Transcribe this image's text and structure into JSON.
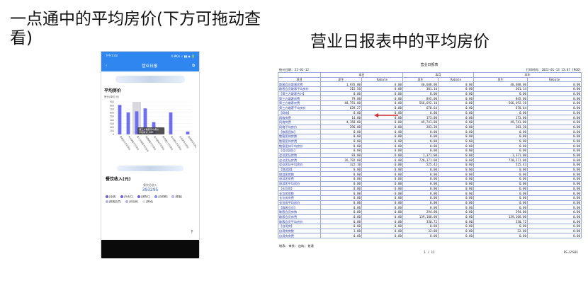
{
  "headings": {
    "left": "一点通中的平均房价(下方可拖动查看)",
    "right": "营业日报表中的平均房价"
  },
  "phone": {
    "status_left": "下午1:43",
    "status_right": "0.8K/s ⚡ ▮▮ ◉ 🔋",
    "title": "营业日报",
    "avg_price_title": "平均房价",
    "unit_label": "房价(单位:元)",
    "y_ticks": [
      "900",
      "800",
      "700",
      "600",
      "500",
      "400",
      "300",
      "200",
      "100",
      "0"
    ],
    "tooltip": [
      "第三方散客平均房价",
      "平均房价: 639"
    ],
    "food_title": "餐饮收入(元)",
    "food_sub": "餐饮总收入",
    "food_value": "393295",
    "legend": [
      {
        "label": "[全部]",
        "color": "#6a5cd6"
      },
      {
        "label": "[外卖汇]",
        "color": "#6a5cd6"
      },
      {
        "label": "[团购汇]",
        "color": "#6a5cd6"
      },
      {
        "label": "[自助餐]",
        "color": "#7d8fe6"
      },
      {
        "label": "[散客]",
        "color": "#b3b3e6"
      },
      {
        "label": "[散客会员]",
        "color": "#b3b3e6"
      },
      {
        "label": "[长包房]",
        "color": "#b3b3e6"
      },
      {
        "label": "[其他]",
        "color": "#e0e0e0"
      }
    ]
  },
  "chart_data": {
    "type": "bar",
    "categories": [
      "散客会员平均房价",
      "协议散客平均房价",
      "第三方散客平均房价",
      "网络散客平均房价",
      "会员团体平均房价",
      "旅游团队平均房价",
      "会议团队平均房价",
      "长包房平均房价",
      "自用房平均房价"
    ],
    "values": [
      815,
      610,
      639,
      720,
      340,
      0,
      610,
      0,
      80
    ],
    "highlight_index": 2,
    "ylim": [
      0,
      900
    ],
    "color": "#6b6ff0"
  },
  "report": {
    "title": "营业日报表",
    "meta_left": "统计日期:   22-01-12",
    "meta_right": "打印时间: 2022-01-13 13:07 [ROO]",
    "group_headers": [
      "本日",
      "本月",
      "本年"
    ],
    "col_headers": [
      "项目",
      "发生",
      "Rebate",
      "发生",
      "Rebate",
      "发生",
      "Rebate"
    ],
    "rows": [
      [
        "散客会员散客房费",
        "1,935.00",
        "0.00",
        "40,688.00",
        "0.00",
        "40,688.00",
        "0.00"
      ],
      [
        "散客会员散客平均房价",
        "315.50",
        "0.00",
        "301.14",
        "0.00",
        "301.14",
        "0.00"
      ],
      [
        "【第三方散客合计】",
        "0.00",
        "0.00",
        "0.00",
        "0.00",
        "0.00",
        "0.00"
      ],
      [
        "第三方散客房费",
        "79.00",
        "0.00",
        "845.00",
        "0.00",
        "845.00",
        "0.00"
      ],
      [
        "第三方散客房费",
        "48,781.00",
        "0.00",
        "566,692.10",
        "0.00",
        "566,692.10",
        "0.00"
      ],
      [
        "第三方散客平均房价",
        "639.27",
        "0.00",
        "670.64",
        "0.00",
        "670.64",
        "0.00"
      ],
      [
        "【网络】",
        "0.00",
        "0.00",
        "0.00",
        "0.00",
        "0.00",
        "0.00"
      ],
      [
        "网络房费",
        "14.00",
        "0.00",
        "173.00",
        "0.00",
        "173.00",
        "0.00"
      ],
      [
        "网络房费",
        "4,150.00",
        "0.00",
        "49,741.00",
        "0.00",
        "49,741.00",
        "0.00"
      ],
      [
        "网络平均房价",
        "296.00",
        "0.00",
        "283.30",
        "0.00",
        "283.30",
        "0.00"
      ],
      [
        "【散客团体】",
        "0.00",
        "0.00",
        "0.00",
        "0.00",
        "0.00",
        "0.00"
      ],
      [
        "散客团体房数",
        "0.00",
        "0.00",
        "0.00",
        "0.00",
        "0.00",
        "0.00"
      ],
      [
        "散客团体房费",
        "0.00",
        "0.00",
        "0.00",
        "0.00",
        "0.00",
        "0.00"
      ],
      [
        "散客团体平均房价",
        "0.00",
        "0.00",
        "0.00",
        "0.00",
        "0.00",
        "0.00"
      ],
      [
        "【会议团队】",
        "0.00",
        "0.00",
        "0.00",
        "0.00",
        "0.00",
        "0.00"
      ],
      [
        "会议团队房数",
        "83.00",
        "0.00",
        "1,371.00",
        "0.00",
        "1,371.00",
        "0.00"
      ],
      [
        "会议团队房费",
        "26,792.00",
        "0.00",
        "720,371.00",
        "0.00",
        "720,371.00",
        "0.00"
      ],
      [
        "会议团队平均房价",
        "322.10",
        "0.00",
        "525.43",
        "0.00",
        "525.43",
        "0.00"
      ],
      [
        "【旅游团】",
        "0.00",
        "0.00",
        "0.00",
        "0.00",
        "0.00",
        "0.00"
      ],
      [
        "旅游团房数",
        "0.00",
        "0.00",
        "0.00",
        "0.00",
        "0.00",
        "0.00"
      ],
      [
        "旅游团房费",
        "0.00",
        "0.00",
        "0.00",
        "0.00",
        "0.00",
        "0.00"
      ],
      [
        "旅游团平均房价",
        "0.00",
        "0.00",
        "0.00",
        "0.00",
        "0.00",
        "0.00"
      ],
      [
        "【长包房】",
        "0.00",
        "0.00",
        "0.00",
        "0.00",
        "0.00",
        "0.00"
      ],
      [
        "长包房房数",
        "0.00",
        "0.00",
        "0.00",
        "0.00",
        "0.00",
        "0.00"
      ],
      [
        "长包房房费",
        "0.00",
        "0.00",
        "0.00",
        "0.00",
        "0.00",
        "0.00"
      ],
      [
        "长包房平均房价",
        "0.00",
        "0.00",
        "0.00",
        "0.00",
        "0.00",
        "0.00"
      ],
      [
        "【散客会员】",
        "0.00",
        "0.00",
        "0.00",
        "0.00",
        "0.00",
        "0.00"
      ],
      [
        "散客会员房数",
        "0.00",
        "0.00",
        "294.00",
        "0.00",
        "294.00",
        "0.00"
      ],
      [
        "散客会员房费",
        "0.00",
        "0.00",
        "139,108.00",
        "0.00",
        "139,108.00",
        "0.00"
      ],
      [
        "散客会员平均房价",
        "0.00",
        "0.00",
        "330.72",
        "0.00",
        "330.72",
        "0.00"
      ],
      [
        "【自用房】",
        "0.00",
        "0.00",
        "0.00",
        "0.00",
        "0.00",
        "0.00"
      ],
      [
        "自用房房数",
        "1.00",
        "0.00",
        "32.00",
        "0.00",
        "32.00",
        "0.00"
      ],
      [
        "自用房房费",
        "0.00",
        "0.00",
        "0.00",
        "0.00",
        "0.00",
        "0.00"
      ]
    ],
    "footer_left": "制表:              审核:              出纳: 普通",
    "footer_page": "1  /  11",
    "footer_right": "RS-SYS01"
  }
}
